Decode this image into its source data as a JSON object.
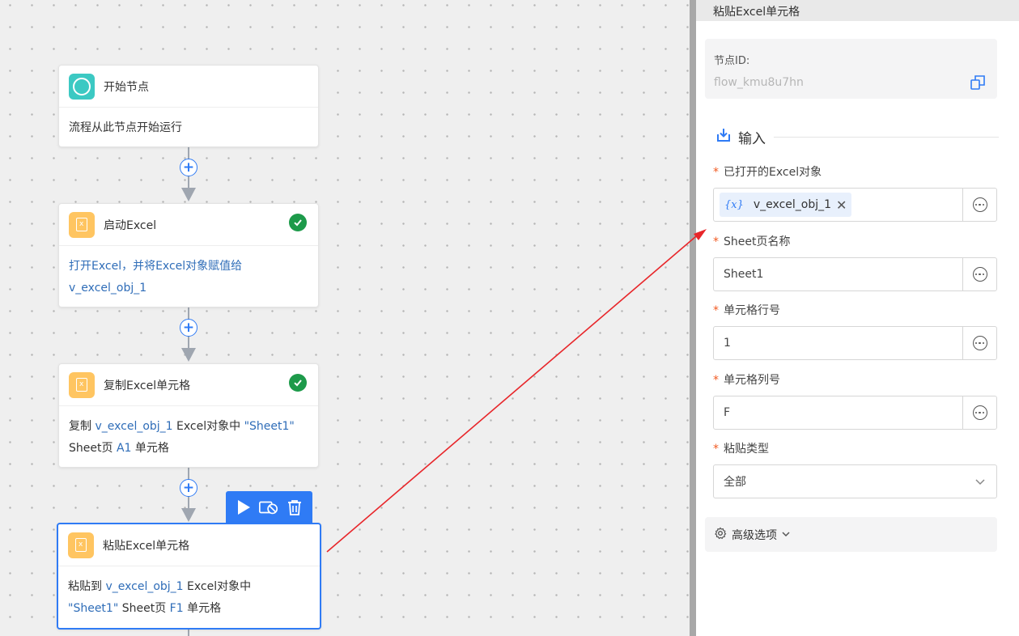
{
  "nodes": [
    {
      "title": "开始节点",
      "desc": "流程从此节点开始运行"
    },
    {
      "title": "启动Excel",
      "desc_prefix": "打开Excel，并将Excel对象赋值给",
      "desc_var": "v_excel_obj_1"
    },
    {
      "title": "复制Excel单元格",
      "d1": "复制 ",
      "d2": "v_excel_obj_1",
      "d3": " Excel对象中 ",
      "d4": "\"Sheet1\"",
      "d5": "Sheet页 ",
      "d6": "A1",
      "d7": " 单元格"
    },
    {
      "title": "粘贴Excel单元格",
      "d1": "粘贴到 ",
      "d2": "v_excel_obj_1",
      "d3": " Excel对象中",
      "d4": "\"Sheet1\"",
      "d5": " Sheet页 ",
      "d6": "F1",
      "d7": " 单元格"
    }
  ],
  "panel": {
    "title": "粘贴Excel单元格",
    "node_id_label": "节点ID:",
    "node_id_value": "flow_kmu8u7hn",
    "section_label": "输入",
    "fields": [
      {
        "label": "已打开的Excel对象",
        "tag_icon": "{x}",
        "value": "v_excel_obj_1"
      },
      {
        "label": "Sheet页名称",
        "value": "Sheet1"
      },
      {
        "label": "单元格行号",
        "value": "1"
      },
      {
        "label": "单元格列号",
        "value": "F"
      },
      {
        "label": "粘贴类型",
        "value": "全部"
      }
    ],
    "required_mark": "*",
    "advanced_label": "高级选项"
  },
  "colors": {
    "accent": "#2f7bf5",
    "success": "#1d9a4a",
    "excel": "#ffc561",
    "start": "#3cc9c3",
    "annotation_arrow": "#e8262a"
  },
  "icons": [
    "start-circle-icon",
    "excel-file-icon",
    "check-circle-icon",
    "plus-circle-icon",
    "play-icon",
    "disable-icon",
    "trash-icon",
    "copy-icon",
    "input-import-icon",
    "more-icon",
    "chevron-down-icon",
    "gear-icon",
    "close-icon"
  ]
}
